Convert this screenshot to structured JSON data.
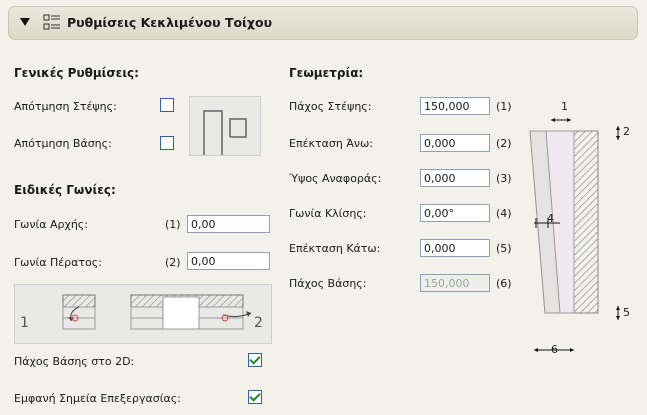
{
  "header": {
    "title": "Ρυθμίσεις Κεκλιμένου Τοίχου",
    "collapse_icon": "triangle-down-icon",
    "settings_icon": "list-settings-icon"
  },
  "general": {
    "title": "Γενικές Ρυθμίσεις:",
    "trim_top_label": "Απότμηση Στέψης:",
    "trim_base_label": "Απότμηση Βάσης:"
  },
  "angles": {
    "title": "Ειδικές Γωνίες:",
    "start_label": "Γωνία Αρχής:",
    "start_num": "(1)",
    "start_value": "0,00",
    "end_label": "Γωνία Πέρατος:",
    "end_num": "(2)",
    "end_value": "0,00",
    "diagram_num1": "1",
    "diagram_num2": "2"
  },
  "options": {
    "base_thickness_2d_label": "Πάχος Βάσης στο 2D:",
    "base_thickness_2d_checked": true,
    "show_hotspots_label": "Εμφανή Σημεία Επεξεργασίας:",
    "show_hotspots_checked": true
  },
  "geometry": {
    "title": "Γεωμετρία:",
    "fields": [
      {
        "label": "Πάχος Στέψης:",
        "value": "150,000",
        "num": "(1)",
        "disabled": false
      },
      {
        "label": "Επέκταση Άνω:",
        "value": "0,000",
        "num": "(2)",
        "disabled": false
      },
      {
        "label": "Ύψος Αναφοράς:",
        "value": "0,000",
        "num": "(3)",
        "disabled": false
      },
      {
        "label": "Γωνία Κλίσης:",
        "value": "0,00°",
        "num": "(4)",
        "disabled": false
      },
      {
        "label": "Επέκταση Κάτω:",
        "value": "0,000",
        "num": "(5)",
        "disabled": false
      },
      {
        "label": "Πάχος Βάσης:",
        "value": "150,000",
        "num": "(6)",
        "disabled": true
      }
    ]
  },
  "diagram": {
    "l1": "1",
    "l2": "2",
    "l4": "4",
    "l5": "5",
    "l6": "6"
  },
  "colors": {
    "panel_bg": "#f3f2ea",
    "checkbox_border": "#2f5fa8",
    "check_mark": "#1e8a2e",
    "hatch": "#8e8e8e"
  }
}
